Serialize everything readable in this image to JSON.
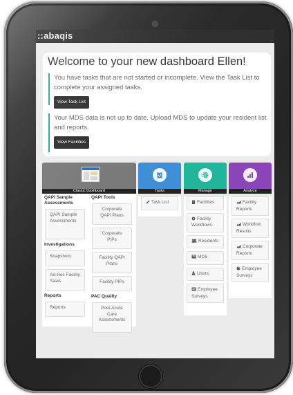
{
  "app": {
    "logo_prefix": "::",
    "logo_text": "abaqis"
  },
  "welcome": {
    "title": "Welcome to your new dashboard Ellen!",
    "message1": "You have tasks that are not started or incomplete. View the Task List to complete your assigned tasks.",
    "button1": "View Task List",
    "message2": "Your MDS data is not up to date. Upload MDS to update your resident list and reports.",
    "button2": "View Facilities"
  },
  "classic": {
    "title": "Classic Dashboard",
    "left": {
      "section1": "QAPI Sample Assessments",
      "item1": "QAPI Sample Assessments",
      "section2": "Investigations",
      "item2": "Snapshots",
      "item3": "Ad-Hoc Facility Tasks",
      "section3": "Reports",
      "item4": "Reports"
    },
    "right": {
      "section1": "QAPI Tools",
      "item1": "Corporate QAPI Plans",
      "item2": "Corporate PIPs",
      "item3": "Facility QAPI Plans",
      "item4": "Facility PIPs",
      "section2": "PAC Quality",
      "item5": "Post-Acute Care Assessments"
    }
  },
  "tasks": {
    "title": "Tasks",
    "item1": "Task List"
  },
  "manage": {
    "title": "Manage",
    "item1": "Facilities",
    "item2": "Facility Workflows",
    "item3": "Residents",
    "item4": "MDS",
    "item5": "Users",
    "item6": "Employee Surveys"
  },
  "analyze": {
    "title": "Analyze",
    "item1": "Facility Reports",
    "item2": "Workflow Results",
    "item3": "Corporate Reports",
    "item4": "Employee Surveys"
  },
  "colors": {
    "classic": "#7a7a7a",
    "tasks": "#3f8fd6",
    "manage": "#21b59b",
    "analyze": "#8c45b8",
    "accent": "#27a3a0"
  }
}
